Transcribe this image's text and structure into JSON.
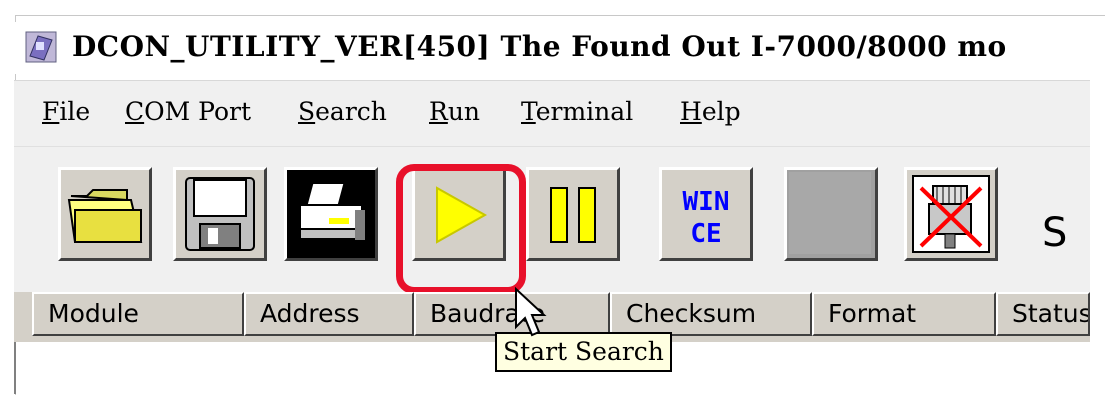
{
  "window": {
    "title": "DCON_UTILITY_VER[450] The Found Out I-7000/8000 mo"
  },
  "menu": [
    {
      "label": "File",
      "underline": "F",
      "rest": "ile"
    },
    {
      "label": "COM Port",
      "underline": "C",
      "rest": "OM Port"
    },
    {
      "label": "Search",
      "underline": "S",
      "rest": "earch"
    },
    {
      "label": "Run",
      "underline": "R",
      "rest": "un"
    },
    {
      "label": "Terminal",
      "underline": "T",
      "rest": "erminal"
    },
    {
      "label": "Help",
      "underline": "H",
      "rest": "elp"
    }
  ],
  "toolbar": {
    "buttons": [
      {
        "name": "open-folder-button",
        "icon": "folder-icon"
      },
      {
        "name": "save-button",
        "icon": "floppy-disk-icon"
      },
      {
        "name": "print-button",
        "icon": "printer-icon"
      },
      {
        "name": "start-search-button",
        "icon": "play-icon",
        "highlighted": true
      },
      {
        "name": "pause-search-button",
        "icon": "pause-icon"
      },
      {
        "name": "wince-button",
        "icon": "wince-icon",
        "text_top": "WIN",
        "text_bottom": "CE"
      },
      {
        "name": "blank-button",
        "icon": "blank-icon"
      },
      {
        "name": "disconnect-button",
        "icon": "disconnect-icon"
      }
    ],
    "trailing_text": "S"
  },
  "list": {
    "columns": [
      "Module",
      "Address",
      "Baudrate",
      "Checksum",
      "Format",
      "Status"
    ]
  },
  "tooltip": {
    "text": "Start Search"
  },
  "colors": {
    "highlight": "#e8102a",
    "play": "#ffff00",
    "tooltip_bg": "#ffffe1",
    "wince_text": "#0000ff"
  }
}
